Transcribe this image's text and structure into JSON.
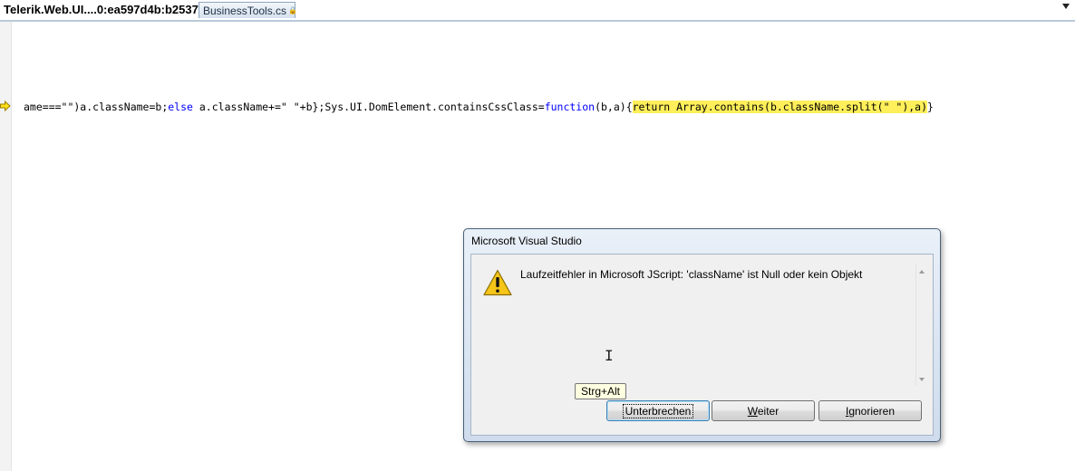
{
  "tabs": [
    {
      "label": "Telerik.Web.UI....0:ea597d4b:b2537",
      "active": true
    },
    {
      "label": "BusinessTools.cs",
      "active": false
    }
  ],
  "tab_lock_icon": "lock-icon",
  "editor": {
    "current_line_marker": "arrow-icon",
    "code_segments": {
      "s1": "ame===\"\")a.className=b;",
      "s2": "else",
      "s3": " a.className+=\" \"+b};Sys.UI.DomElement.containsCssClass=",
      "s4": "function",
      "s5": "(b,a){",
      "s6": "return Array.contains(b.className.split(\" \"),a)",
      "s7": "}"
    },
    "colors": {
      "keyword": "#0000ff",
      "highlight": "#ffef5a"
    }
  },
  "dialog": {
    "title": "Microsoft Visual Studio",
    "icon": "warning-icon",
    "message": "Laufzeitfehler in Microsoft JScript: 'className' ist Null oder kein Objekt",
    "tooltip": "Strg+Alt",
    "buttons": {
      "break": {
        "label": "Unterbrechen"
      },
      "continue": {
        "first": "W",
        "rest": "eiter"
      },
      "ignore": {
        "first": "I",
        "rest": "gnorieren"
      }
    }
  }
}
